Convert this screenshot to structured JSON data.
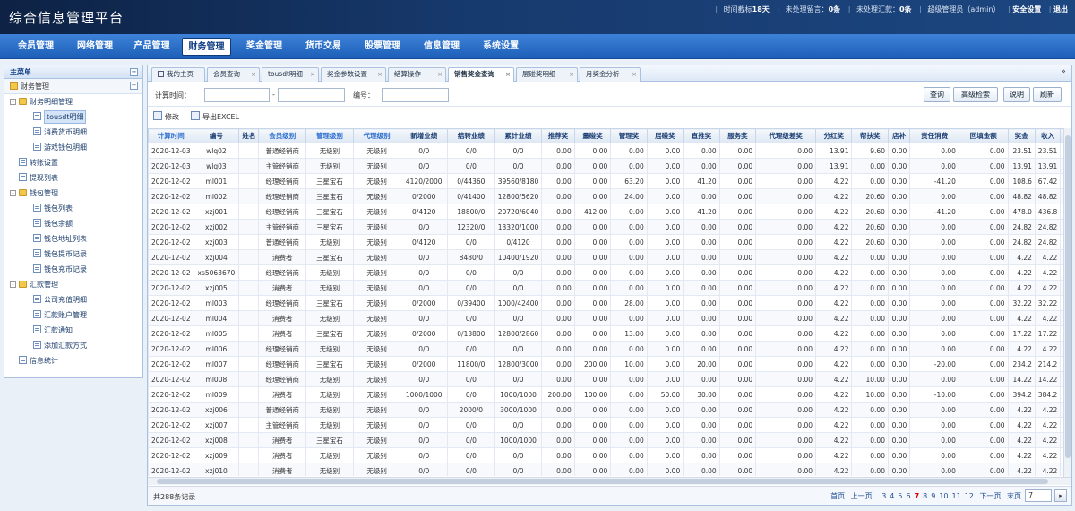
{
  "app_title": "综合信息管理平台",
  "top_info": {
    "days_label": "时间截标",
    "days_value": "18天",
    "msg_label": "未处理留言：",
    "msg_value": "0条",
    "remit_label": "未处理汇款：",
    "remit_value": "0条",
    "admin": "超级管理员（admin）",
    "security": "安全设置",
    "logout": "退出"
  },
  "nav": [
    "会员管理",
    "网络管理",
    "产品管理",
    "财务管理",
    "奖金管理",
    "货币交易",
    "股票管理",
    "信息管理",
    "系统设置"
  ],
  "sidebar": {
    "title": "主菜单",
    "section": "财务管理",
    "items": [
      {
        "label": "财务明细管理",
        "level": 0,
        "type": "folder",
        "pm": "-"
      },
      {
        "label": "tousdt明细",
        "level": 1,
        "type": "page",
        "selected": true
      },
      {
        "label": "消费货币明细",
        "level": 1,
        "type": "page"
      },
      {
        "label": "游戏钱包明细",
        "level": 1,
        "type": "page"
      },
      {
        "label": "转账设置",
        "level": 0,
        "type": "page"
      },
      {
        "label": "提现列表",
        "level": 0,
        "type": "page"
      },
      {
        "label": "钱包管理",
        "level": 0,
        "type": "folder",
        "pm": "-"
      },
      {
        "label": "钱包列表",
        "level": 1,
        "type": "page"
      },
      {
        "label": "钱包余额",
        "level": 1,
        "type": "page"
      },
      {
        "label": "钱包地址列表",
        "level": 1,
        "type": "page"
      },
      {
        "label": "钱包提币记录",
        "level": 1,
        "type": "page"
      },
      {
        "label": "钱包充币记录",
        "level": 1,
        "type": "page"
      },
      {
        "label": "汇款管理",
        "level": 0,
        "type": "folder",
        "pm": "-"
      },
      {
        "label": "公司充值明细",
        "level": 1,
        "type": "page"
      },
      {
        "label": "汇款账户管理",
        "level": 1,
        "type": "page"
      },
      {
        "label": "汇款通知",
        "level": 1,
        "type": "page"
      },
      {
        "label": "添加汇款方式",
        "level": 1,
        "type": "page"
      },
      {
        "label": "信息统计",
        "level": 0,
        "type": "page"
      }
    ]
  },
  "tabs": [
    "我的主页",
    "会员查询",
    "tousdt明细",
    "奖金参数设置",
    "结算操作",
    "销售奖金查询",
    "层碰奖明细",
    "月奖金分析"
  ],
  "active_tab": 5,
  "query": {
    "time_label": "计算时间：",
    "sep": "-",
    "id_label": "编号：",
    "search": "查询",
    "advanced": "高级检索",
    "help": "说明",
    "refresh": "刷新"
  },
  "actions": {
    "edit": "修改",
    "export": "导出EXCEL"
  },
  "columns": [
    "计算时间",
    "编号",
    "姓名",
    "会员级别",
    "管理级别",
    "代理级别",
    "新增业绩",
    "结转业绩",
    "累计业绩",
    "推荐奖",
    "量碰奖",
    "管理奖",
    "层碰奖",
    "直推奖",
    "服务奖",
    "代理级差奖",
    "分红奖",
    "帮扶奖",
    "店补",
    "责任消费",
    "回填金额",
    "奖金",
    "收入",
    "累"
  ],
  "rows": [
    [
      "2020-12-03",
      "wlq02",
      "",
      "普通经销商",
      "无级别",
      "无级别",
      "0/0",
      "0/0",
      "0/0",
      "0.00",
      "0.00",
      "0.00",
      "0.00",
      "0.00",
      "0.00",
      "0.00",
      "13.91",
      "9.60",
      "0.00",
      "0.00",
      "0.00",
      "23.51",
      "23.51"
    ],
    [
      "2020-12-03",
      "wlq03",
      "",
      "主管经销商",
      "无级别",
      "无级别",
      "0/0",
      "0/0",
      "0/0",
      "0.00",
      "0.00",
      "0.00",
      "0.00",
      "0.00",
      "0.00",
      "0.00",
      "13.91",
      "0.00",
      "0.00",
      "0.00",
      "0.00",
      "13.91",
      "13.91"
    ],
    [
      "2020-12-02",
      "ml001",
      "",
      "经理经销商",
      "三星宝石",
      "无级别",
      "4120/2000",
      "0/44360",
      "39560/8180",
      "0.00",
      "0.00",
      "63.20",
      "0.00",
      "41.20",
      "0.00",
      "0.00",
      "4.22",
      "0.00",
      "0.00",
      "-41.20",
      "0.00",
      "108.6",
      "67.42"
    ],
    [
      "2020-12-02",
      "ml002",
      "",
      "经理经销商",
      "三星宝石",
      "无级别",
      "0/2000",
      "0/41400",
      "12800/5620",
      "0.00",
      "0.00",
      "24.00",
      "0.00",
      "0.00",
      "0.00",
      "0.00",
      "4.22",
      "20.60",
      "0.00",
      "0.00",
      "0.00",
      "48.82",
      "48.82"
    ],
    [
      "2020-12-02",
      "xzj001",
      "",
      "经理经销商",
      "三星宝石",
      "无级别",
      "0/4120",
      "18800/0",
      "20720/6040",
      "0.00",
      "412.00",
      "0.00",
      "0.00",
      "41.20",
      "0.00",
      "0.00",
      "4.22",
      "20.60",
      "0.00",
      "-41.20",
      "0.00",
      "478.0",
      "436.8"
    ],
    [
      "2020-12-02",
      "xzj002",
      "",
      "主管经销商",
      "三星宝石",
      "无级别",
      "0/0",
      "12320/0",
      "13320/1000",
      "0.00",
      "0.00",
      "0.00",
      "0.00",
      "0.00",
      "0.00",
      "0.00",
      "4.22",
      "20.60",
      "0.00",
      "0.00",
      "0.00",
      "24.82",
      "24.82"
    ],
    [
      "2020-12-02",
      "xzj003",
      "",
      "普通经销商",
      "无级别",
      "无级别",
      "0/4120",
      "0/0",
      "0/4120",
      "0.00",
      "0.00",
      "0.00",
      "0.00",
      "0.00",
      "0.00",
      "0.00",
      "4.22",
      "20.60",
      "0.00",
      "0.00",
      "0.00",
      "24.82",
      "24.82"
    ],
    [
      "2020-12-02",
      "xzj004",
      "",
      "消费者",
      "三星宝石",
      "无级别",
      "0/0",
      "8480/0",
      "10400/1920",
      "0.00",
      "0.00",
      "0.00",
      "0.00",
      "0.00",
      "0.00",
      "0.00",
      "4.22",
      "0.00",
      "0.00",
      "0.00",
      "0.00",
      "4.22",
      "4.22"
    ],
    [
      "2020-12-02",
      "xs5063670",
      "",
      "经理经销商",
      "无级别",
      "无级别",
      "0/0",
      "0/0",
      "0/0",
      "0.00",
      "0.00",
      "0.00",
      "0.00",
      "0.00",
      "0.00",
      "0.00",
      "4.22",
      "0.00",
      "0.00",
      "0.00",
      "0.00",
      "4.22",
      "4.22"
    ],
    [
      "2020-12-02",
      "xzj005",
      "",
      "消费者",
      "无级别",
      "无级别",
      "0/0",
      "0/0",
      "0/0",
      "0.00",
      "0.00",
      "0.00",
      "0.00",
      "0.00",
      "0.00",
      "0.00",
      "4.22",
      "0.00",
      "0.00",
      "0.00",
      "0.00",
      "4.22",
      "4.22"
    ],
    [
      "2020-12-02",
      "ml003",
      "",
      "经理经销商",
      "三星宝石",
      "无级别",
      "0/2000",
      "0/39400",
      "1000/42400",
      "0.00",
      "0.00",
      "28.00",
      "0.00",
      "0.00",
      "0.00",
      "0.00",
      "4.22",
      "0.00",
      "0.00",
      "0.00",
      "0.00",
      "32.22",
      "32.22"
    ],
    [
      "2020-12-02",
      "ml004",
      "",
      "消费者",
      "无级别",
      "无级别",
      "0/0",
      "0/0",
      "0/0",
      "0.00",
      "0.00",
      "0.00",
      "0.00",
      "0.00",
      "0.00",
      "0.00",
      "4.22",
      "0.00",
      "0.00",
      "0.00",
      "0.00",
      "4.22",
      "4.22"
    ],
    [
      "2020-12-02",
      "ml005",
      "",
      "消费者",
      "三星宝石",
      "无级别",
      "0/2000",
      "0/13800",
      "12800/2860",
      "0.00",
      "0.00",
      "13.00",
      "0.00",
      "0.00",
      "0.00",
      "0.00",
      "4.22",
      "0.00",
      "0.00",
      "0.00",
      "0.00",
      "17.22",
      "17.22"
    ],
    [
      "2020-12-02",
      "ml006",
      "",
      "经理经销商",
      "无级别",
      "无级别",
      "0/0",
      "0/0",
      "0/0",
      "0.00",
      "0.00",
      "0.00",
      "0.00",
      "0.00",
      "0.00",
      "0.00",
      "4.22",
      "0.00",
      "0.00",
      "0.00",
      "0.00",
      "4.22",
      "4.22"
    ],
    [
      "2020-12-02",
      "ml007",
      "",
      "经理经销商",
      "三星宝石",
      "无级别",
      "0/2000",
      "11800/0",
      "12800/3000",
      "0.00",
      "200.00",
      "10.00",
      "0.00",
      "20.00",
      "0.00",
      "0.00",
      "4.22",
      "0.00",
      "0.00",
      "-20.00",
      "0.00",
      "234.2",
      "214.2"
    ],
    [
      "2020-12-02",
      "ml008",
      "",
      "经理经销商",
      "无级别",
      "无级别",
      "0/0",
      "0/0",
      "0/0",
      "0.00",
      "0.00",
      "0.00",
      "0.00",
      "0.00",
      "0.00",
      "0.00",
      "4.22",
      "10.00",
      "0.00",
      "0.00",
      "0.00",
      "14.22",
      "14.22"
    ],
    [
      "2020-12-02",
      "ml009",
      "",
      "消费者",
      "无级别",
      "无级别",
      "1000/1000",
      "0/0",
      "1000/1000",
      "200.00",
      "100.00",
      "0.00",
      "50.00",
      "30.00",
      "0.00",
      "0.00",
      "4.22",
      "10.00",
      "0.00",
      "-10.00",
      "0.00",
      "394.2",
      "384.2"
    ],
    [
      "2020-12-02",
      "xzj006",
      "",
      "普通经销商",
      "无级别",
      "无级别",
      "0/0",
      "2000/0",
      "3000/1000",
      "0.00",
      "0.00",
      "0.00",
      "0.00",
      "0.00",
      "0.00",
      "0.00",
      "4.22",
      "0.00",
      "0.00",
      "0.00",
      "0.00",
      "4.22",
      "4.22"
    ],
    [
      "2020-12-02",
      "xzj007",
      "",
      "主管经销商",
      "无级别",
      "无级别",
      "0/0",
      "0/0",
      "0/0",
      "0.00",
      "0.00",
      "0.00",
      "0.00",
      "0.00",
      "0.00",
      "0.00",
      "4.22",
      "0.00",
      "0.00",
      "0.00",
      "0.00",
      "4.22",
      "4.22"
    ],
    [
      "2020-12-02",
      "xzj008",
      "",
      "消费者",
      "三星宝石",
      "无级别",
      "0/0",
      "0/0",
      "1000/1000",
      "0.00",
      "0.00",
      "0.00",
      "0.00",
      "0.00",
      "0.00",
      "0.00",
      "4.22",
      "0.00",
      "0.00",
      "0.00",
      "0.00",
      "4.22",
      "4.22"
    ],
    [
      "2020-12-02",
      "xzj009",
      "",
      "消费者",
      "无级别",
      "无级别",
      "0/0",
      "0/0",
      "0/0",
      "0.00",
      "0.00",
      "0.00",
      "0.00",
      "0.00",
      "0.00",
      "0.00",
      "4.22",
      "0.00",
      "0.00",
      "0.00",
      "0.00",
      "4.22",
      "4.22"
    ],
    [
      "2020-12-02",
      "xzj010",
      "",
      "消费者",
      "无级别",
      "无级别",
      "0/0",
      "0/0",
      "0/0",
      "0.00",
      "0.00",
      "0.00",
      "0.00",
      "0.00",
      "0.00",
      "0.00",
      "4.22",
      "0.00",
      "0.00",
      "0.00",
      "0.00",
      "4.22",
      "4.22"
    ]
  ],
  "footer": {
    "total": "共288条记录",
    "first": "首页",
    "prev": "上一页",
    "pages": [
      "3",
      "4",
      "5",
      "6",
      "7",
      "8",
      "9",
      "10",
      "11",
      "12"
    ],
    "current": "7",
    "next": "下一页",
    "last": "末页",
    "goto_value": "7"
  }
}
